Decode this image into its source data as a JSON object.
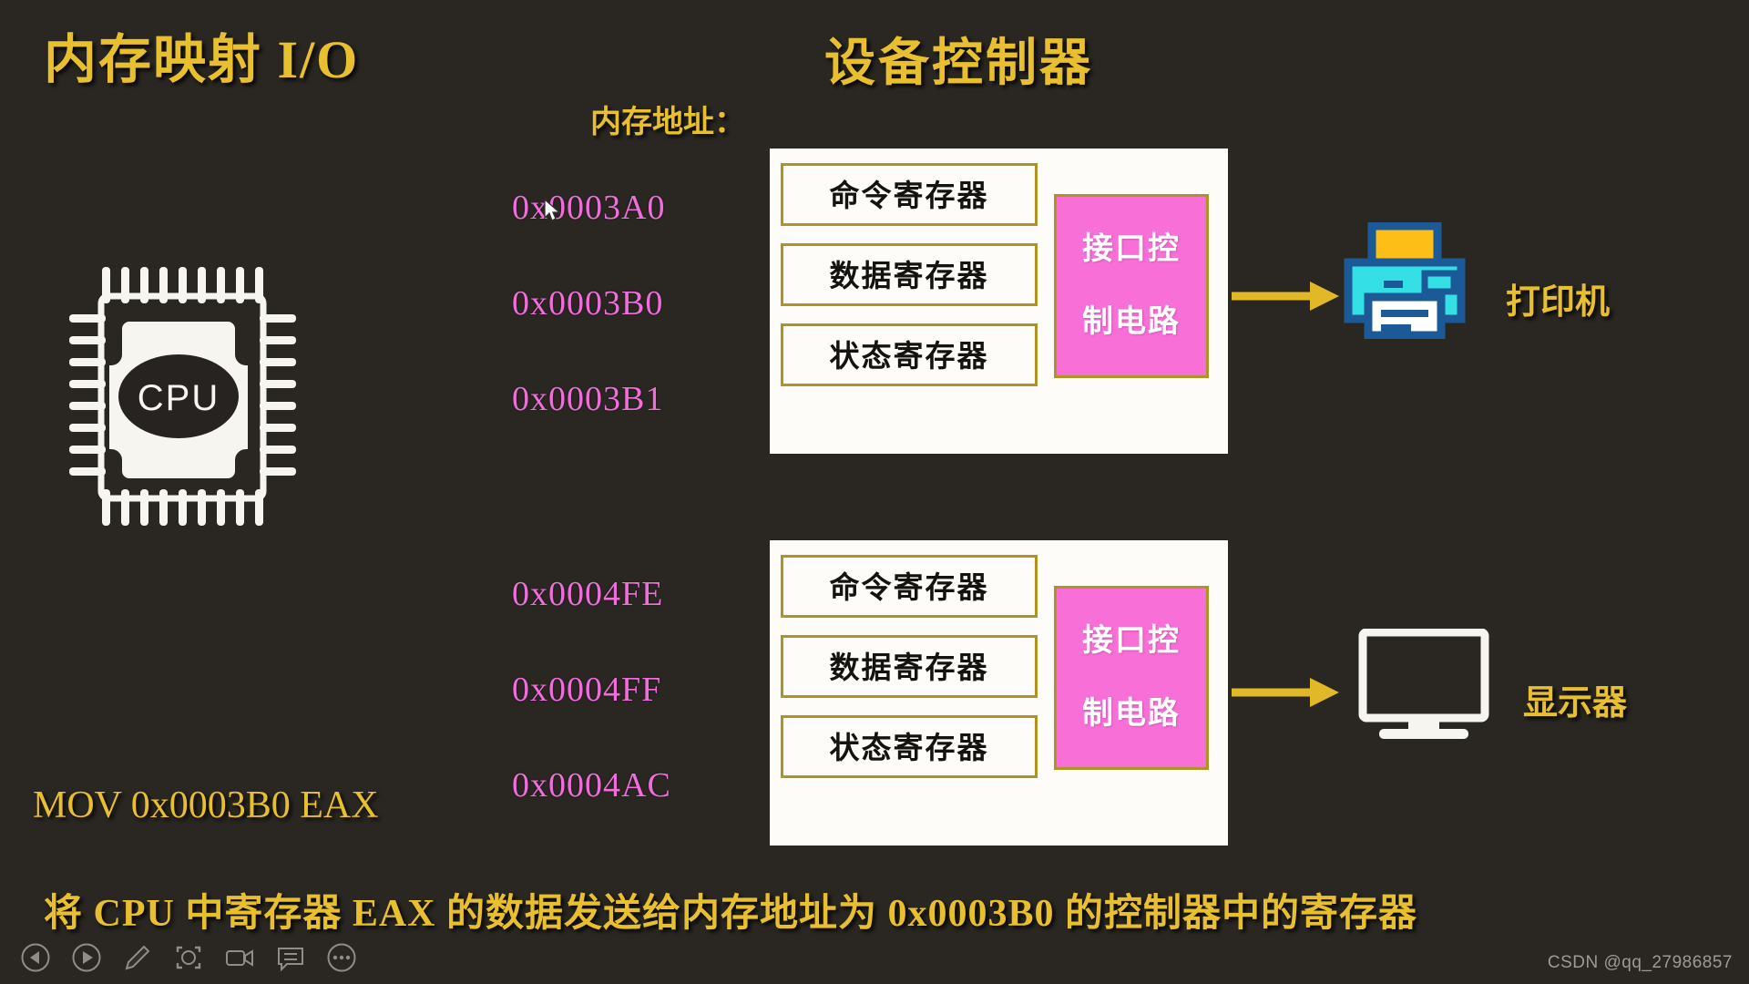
{
  "slide": {
    "background_color": "#2a2722",
    "accent_gold": "#e8bf2e",
    "accent_pink": "#f06edc",
    "iface_pink": "#f96fd8",
    "title": "内存映射 I/O",
    "device_title": "设备控制器",
    "memory_address_label": "内存地址：",
    "mov_instruction": "MOV 0x0003B0 EAX",
    "caption": "将 CPU 中寄存器 EAX 的数据发送给内存地址为 0x0003B0 的控制器中的寄存器"
  },
  "cpu": {
    "label": "CPU"
  },
  "controllers": [
    {
      "id": "printer-controller",
      "addresses": [
        "0x0003A0",
        "0x0003B0",
        "0x0003B1"
      ],
      "registers": [
        "命令寄存器",
        "数据寄存器",
        "状态寄存器"
      ],
      "interface_line1": "接口控",
      "interface_line2": "制电路",
      "device_label": "打印机",
      "device_icon": "printer-icon"
    },
    {
      "id": "monitor-controller",
      "addresses": [
        "0x0004FE",
        "0x0004FF",
        "0x0004AC"
      ],
      "registers": [
        "命令寄存器",
        "数据寄存器",
        "状态寄存器"
      ],
      "interface_line1": "接口控",
      "interface_line2": "制电路",
      "device_label": "显示器",
      "device_icon": "monitor-icon"
    }
  ],
  "toolbar": {
    "items": [
      {
        "name": "previous-slide-button",
        "icon": "prev-circle-icon"
      },
      {
        "name": "play-button",
        "icon": "play-circle-icon"
      },
      {
        "name": "annotate-button",
        "icon": "pencil-icon"
      },
      {
        "name": "focus-button",
        "icon": "focus-frame-icon"
      },
      {
        "name": "record-button",
        "icon": "video-camera-icon"
      },
      {
        "name": "comment-button",
        "icon": "comment-bubble-icon"
      },
      {
        "name": "more-options-button",
        "icon": "more-dots-icon"
      }
    ]
  },
  "watermark": "CSDN @qq_27986857"
}
